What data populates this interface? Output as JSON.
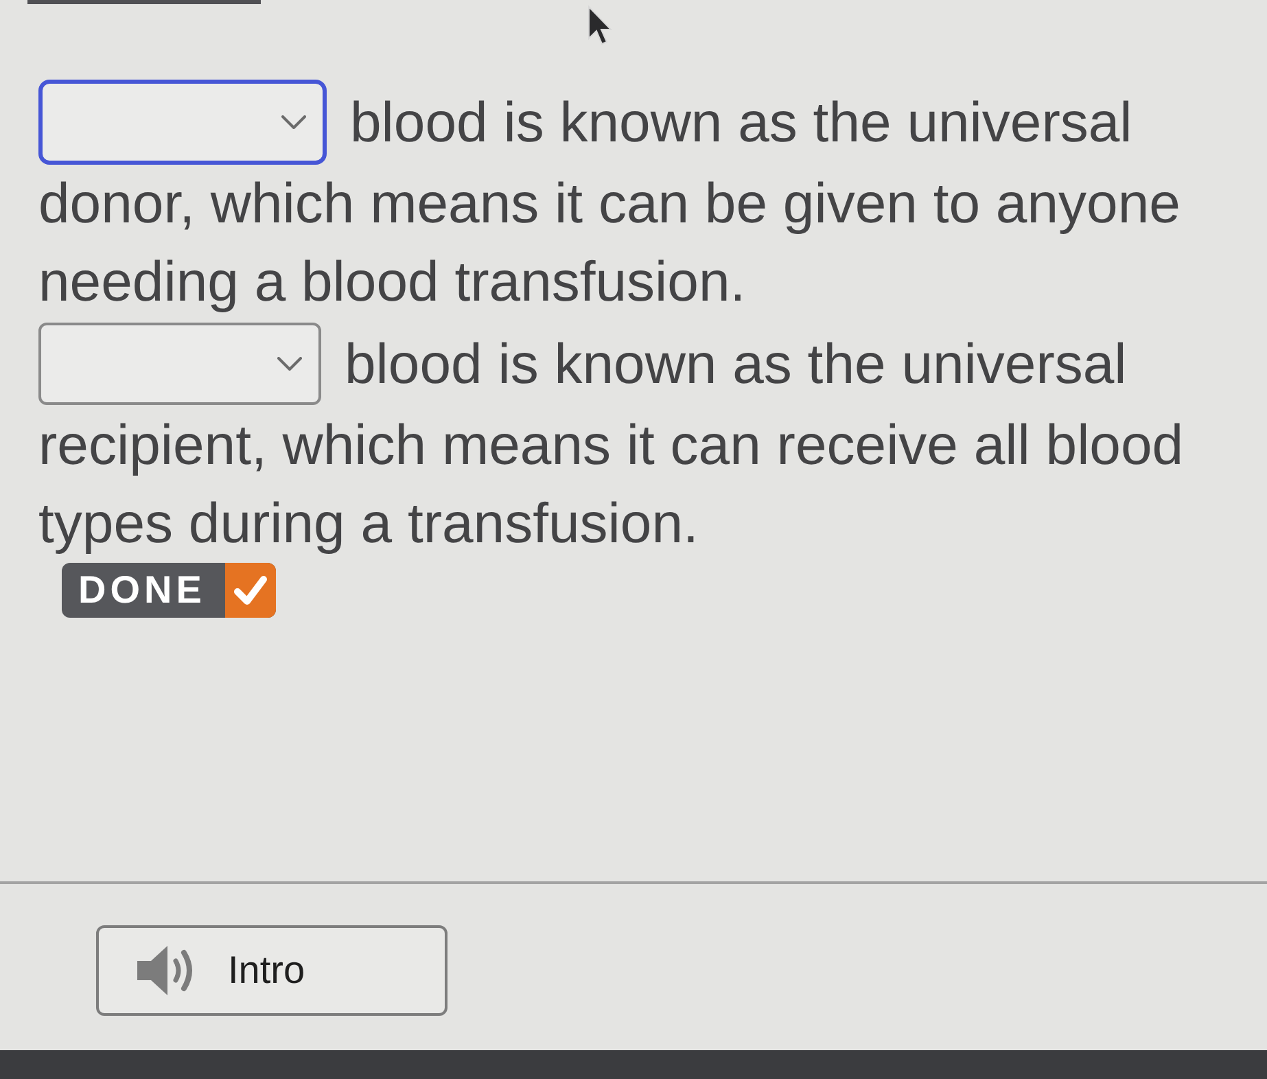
{
  "questions": [
    {
      "field": {
        "focused": true
      },
      "text_beside_field": "blood is known as the universal",
      "text_below_field": "donor, which means it can be given to anyone needing a blood transfusion."
    },
    {
      "field": {
        "focused": false
      },
      "text_beside_field": "blood is known as the universal",
      "text_below_field": "recipient, which means it can receive all blood types during a transfusion."
    }
  ],
  "done_button": {
    "label": "DONE"
  },
  "intro_button": {
    "label": "Intro"
  }
}
